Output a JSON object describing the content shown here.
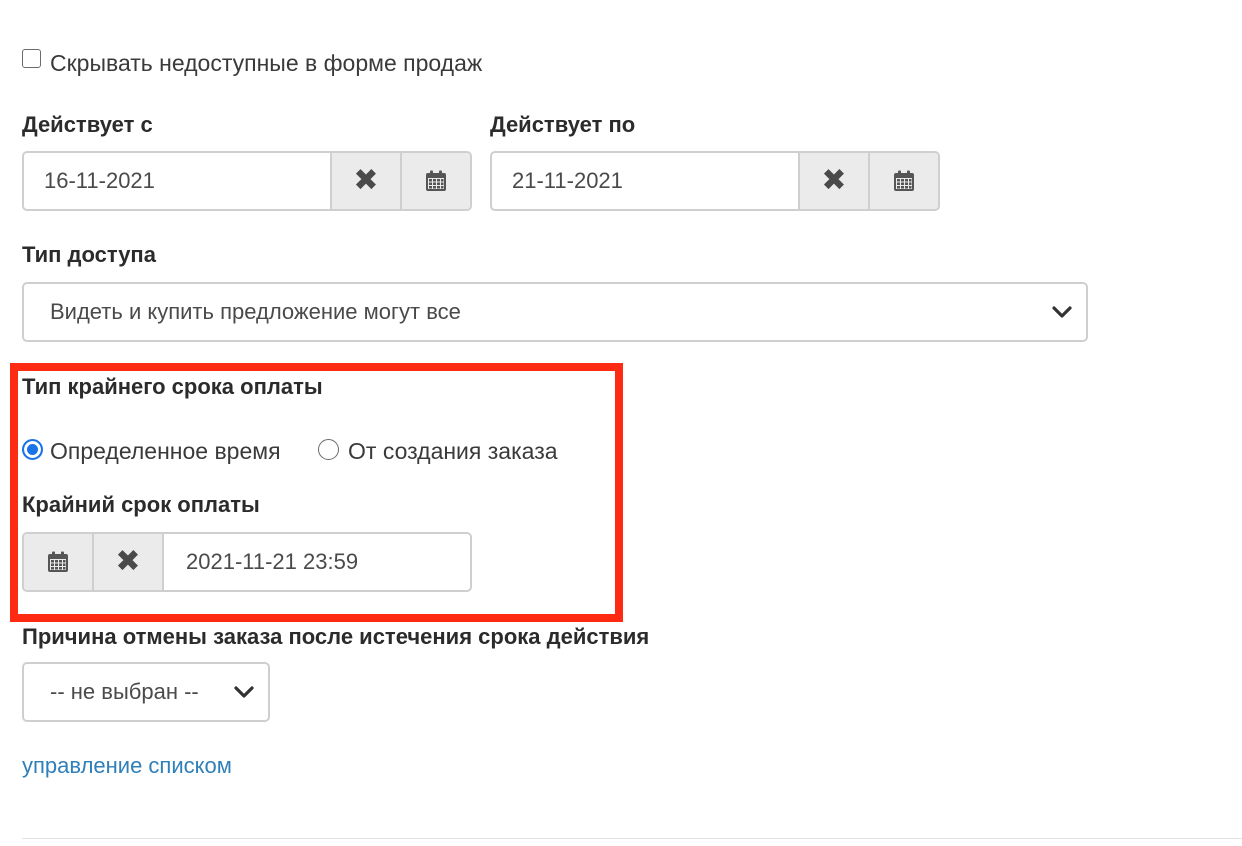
{
  "hide_unavailable": {
    "label": "Скрывать недоступные в форме продаж",
    "checked": false
  },
  "valid_from": {
    "label": "Действует с",
    "value": "16-11-2021"
  },
  "valid_to": {
    "label": "Действует по",
    "value": "21-11-2021"
  },
  "access_type": {
    "label": "Тип доступа",
    "selected": "Видеть и купить предложение могут все"
  },
  "payment_deadline_type": {
    "label": "Тип крайнего срока оплаты",
    "options": [
      {
        "label": "Определенное время",
        "checked": true
      },
      {
        "label": "От создания заказа",
        "checked": false
      }
    ]
  },
  "payment_deadline": {
    "label": "Крайний срок оплаты",
    "value": "2021-11-21 23:59"
  },
  "cancel_reason": {
    "label": "Причина отмены заказа после истечения срока действия",
    "selected": "-- не выбран --",
    "manage_link": "управление списком"
  },
  "colors": {
    "highlight": "#ff2a12",
    "link": "#2f7fb8",
    "radio_accent": "#1a73e8"
  },
  "icons": [
    "calendar-icon",
    "clear-icon",
    "chevron-down-icon"
  ]
}
